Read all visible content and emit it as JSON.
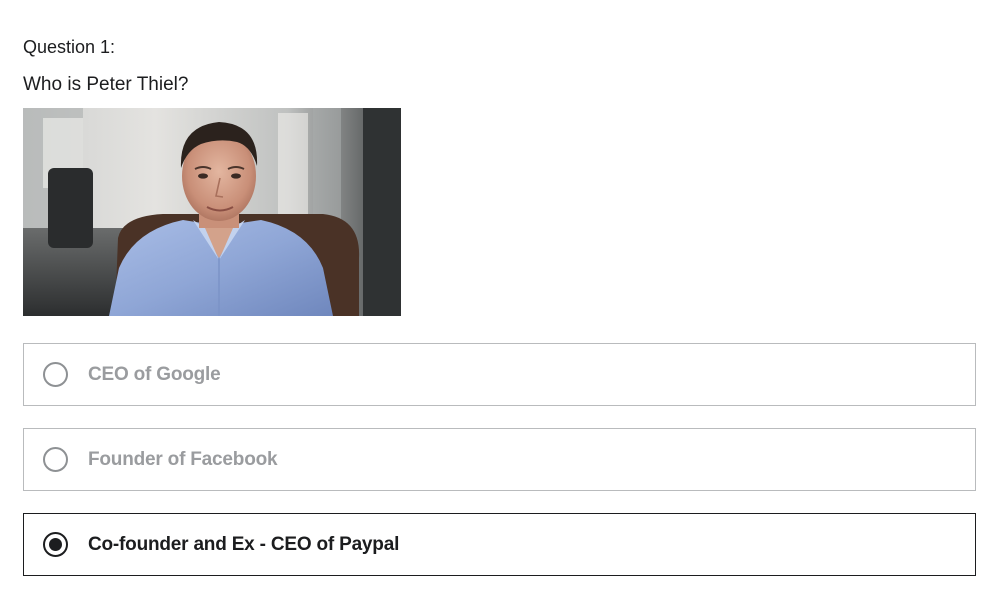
{
  "question": {
    "number_label": "Question 1:",
    "text": "Who is Peter Thiel?",
    "image": {
      "alt": "Peter Thiel"
    }
  },
  "options": [
    {
      "label": "CEO of Google",
      "selected": false
    },
    {
      "label": "Founder of Facebook",
      "selected": false
    },
    {
      "label": "Co-founder and Ex - CEO of Paypal",
      "selected": true
    }
  ],
  "colors": {
    "text": "#1c1d1f",
    "muted_text": "#9a9c9f",
    "border": "#b9bbbd",
    "selected_border": "#1c1d1f"
  }
}
